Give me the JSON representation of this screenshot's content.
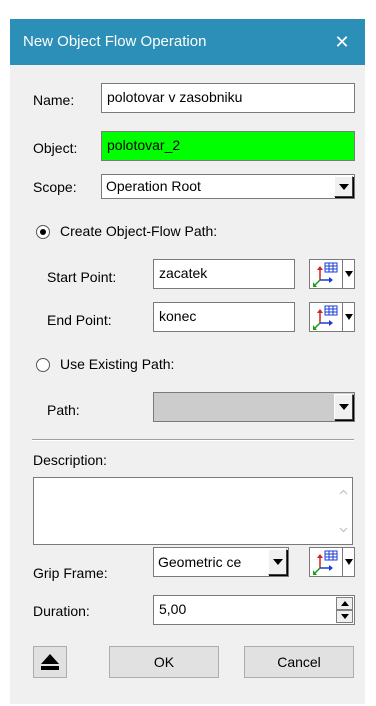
{
  "dialog": {
    "title": "New Object Flow Operation",
    "close_glyph": "✕"
  },
  "form": {
    "name_label": "Name:",
    "name_value": "polotovar v zasobniku",
    "object_label": "Object:",
    "object_value": "polotovar_2",
    "object_highlight_color": "#00ff00",
    "scope_label": "Scope:",
    "scope_value": "Operation Root",
    "create_path_label": "Create Object-Flow Path:",
    "create_path_selected": true,
    "start_point_label": "Start Point:",
    "start_point_value": "zacatek",
    "end_point_label": "End Point:",
    "end_point_value": "konec",
    "use_existing_label": "Use Existing Path:",
    "use_existing_selected": false,
    "path_label": "Path:",
    "path_value": "",
    "description_label": "Description:",
    "description_value": "",
    "grip_frame_label": "Grip Frame:",
    "grip_frame_value": "Geometric ce",
    "duration_label": "Duration:",
    "duration_value": "5,00"
  },
  "buttons": {
    "ok_label": "OK",
    "cancel_label": "Cancel"
  },
  "icons": {
    "close": "close-icon",
    "dropdown": "chevron-down-icon",
    "frame_picker": "coordinate-frame-icon",
    "collapse": "collapse-up-icon"
  },
  "colors": {
    "titlebar": "#2b8fb8",
    "dialog_bg": "#f0f0f0",
    "disabled_field": "#cccccc"
  }
}
